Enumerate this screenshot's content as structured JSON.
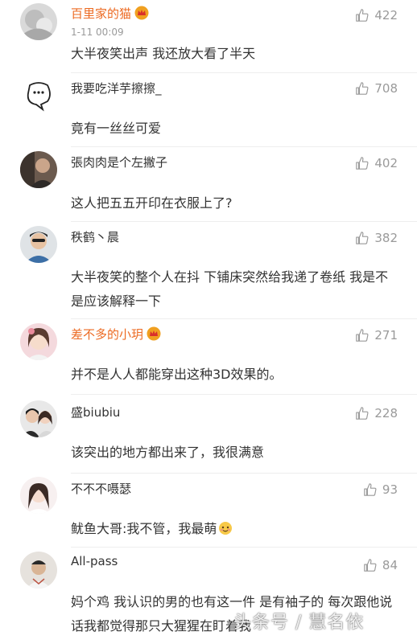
{
  "comments": [
    {
      "user": "百里家的猫",
      "time": "1-11 00:09",
      "likes": "422",
      "text": "大半夜笑出声 我还放大看了半天"
    },
    {
      "user": "我要吃洋芋擦擦_",
      "likes": "708",
      "text": "竟有一丝丝可爱"
    },
    {
      "user": "張肉肉是个左撇子",
      "likes": "402",
      "text": "这人把五五开印在衣服上了?"
    },
    {
      "user": "秩鹤丶晨",
      "likes": "382",
      "text": "大半夜笑的整个人在抖 下铺床突然给我递了卷纸 我是不是应该解释一下"
    },
    {
      "user": "差不多的小玥",
      "likes": "271",
      "text": "并不是人人都能穿出这种3D效果的。"
    },
    {
      "user": "盛biubiu",
      "likes": "228",
      "text": "该突出的地方都出来了，我很满意"
    },
    {
      "user": "不不不嗫瑟",
      "likes": "93",
      "text": "鱿鱼大哥:我不管，我最萌"
    },
    {
      "user": "All-pass",
      "likes": "84",
      "text": "妈个鸡 我认识的男的也有这一件 是有袖子的 每次跟他说话我都觉得那只大猩猩在盯着我"
    }
  ],
  "watermark": "头条号 / 慧名依",
  "colors": {
    "vip_name": "#ec6a22",
    "meta": "#9a9a9a",
    "text": "#333333"
  }
}
